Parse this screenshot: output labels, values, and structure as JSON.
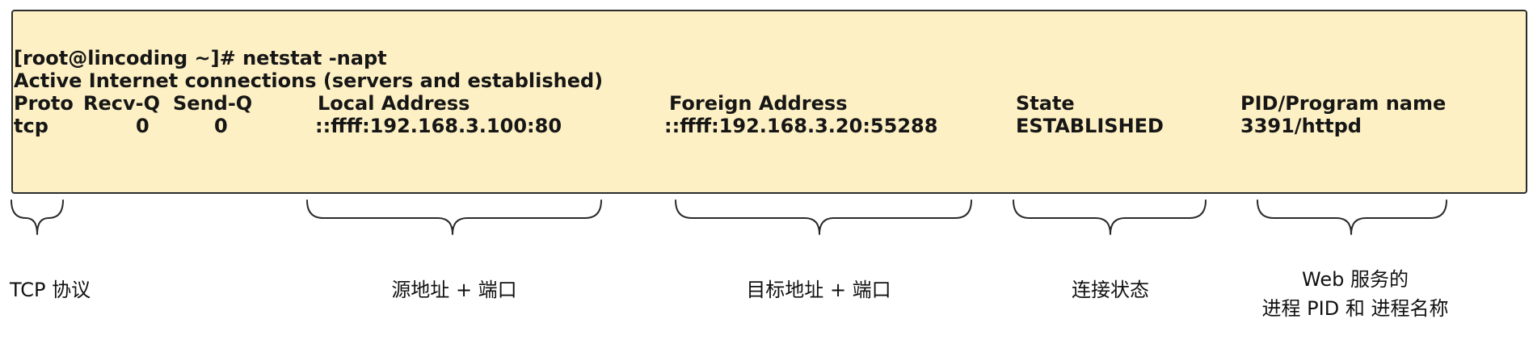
{
  "terminal": {
    "prompt_line": "[root@lincoding ~]# netstat -napt",
    "info_line": "Active Internet connections (servers and established)",
    "headers": {
      "proto": "Proto",
      "recvq": "Recv-Q",
      "sendq": "Send-Q",
      "local": "Local Address",
      "foreign": "Foreign Address",
      "state": "State",
      "pid": "PID/Program name"
    },
    "row": {
      "proto": "tcp",
      "recvq": "0",
      "sendq": "0",
      "local": "::ffff:192.168.3.100:80",
      "foreign": "::ffff:192.168.3.20:55288",
      "state": "ESTABLISHED",
      "pid": "3391/httpd"
    }
  },
  "annotations": {
    "proto": "TCP 协议",
    "local": "源地址 + 端口",
    "foreign": "目标地址 + 端口",
    "state": "连接状态",
    "pid_line1": "Web 服务的",
    "pid_line2": "进程 PID 和 进程名称"
  },
  "colors": {
    "box_fill": "#fdf0c4",
    "box_border": "#2c2c2c",
    "text": "#161616"
  }
}
